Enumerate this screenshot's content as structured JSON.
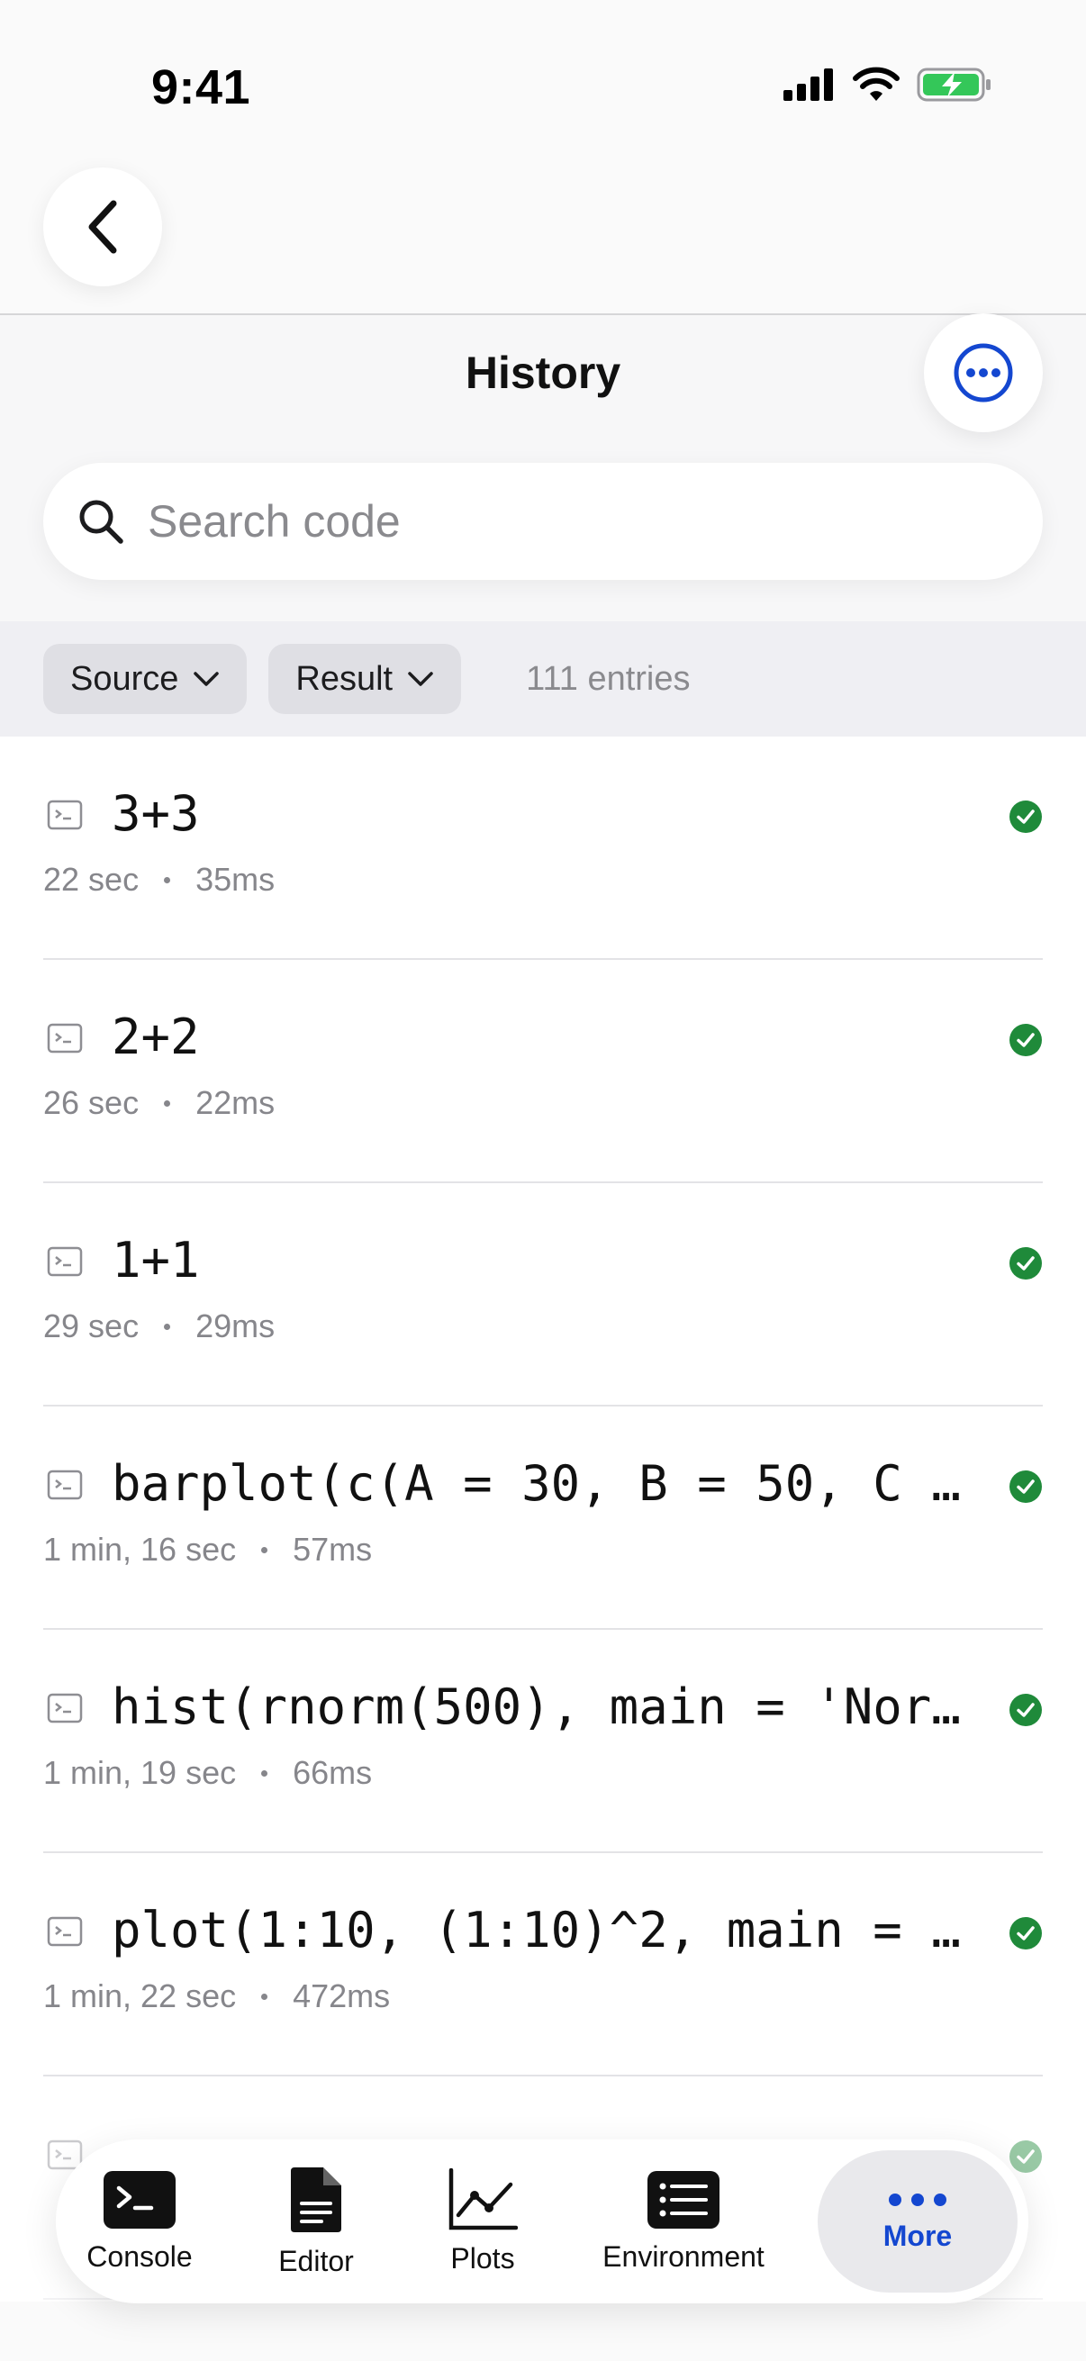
{
  "status_bar": {
    "time": "9:41"
  },
  "header": {
    "title": "History"
  },
  "search": {
    "placeholder": "Search code",
    "value": ""
  },
  "filters": {
    "source_label": "Source",
    "result_label": "Result",
    "entries": "111 entries"
  },
  "history": [
    {
      "code": "3+3",
      "ago": "22 sec",
      "duration": "35ms",
      "status": "success"
    },
    {
      "code": "2+2",
      "ago": "26 sec",
      "duration": "22ms",
      "status": "success"
    },
    {
      "code": "1+1",
      "ago": "29 sec",
      "duration": "29ms",
      "status": "success"
    },
    {
      "code": "barplot(c(A = 30, B = 50, C =…",
      "ago": "1 min, 16 sec",
      "duration": "57ms",
      "status": "success"
    },
    {
      "code": "hist(rnorm(500), main = 'Norm…",
      "ago": "1 min, 19 sec",
      "duration": "66ms",
      "status": "success"
    },
    {
      "code": "plot(1:10, (1:10)^2, main = '…",
      "ago": "1 min, 22 sec",
      "duration": "472ms",
      "status": "success"
    }
  ],
  "tabs": {
    "console": "Console",
    "editor": "Editor",
    "plots": "Plots",
    "environment": "Environment",
    "more": "More"
  },
  "colors": {
    "accent": "#1447d0",
    "success": "#1f8a3a"
  }
}
